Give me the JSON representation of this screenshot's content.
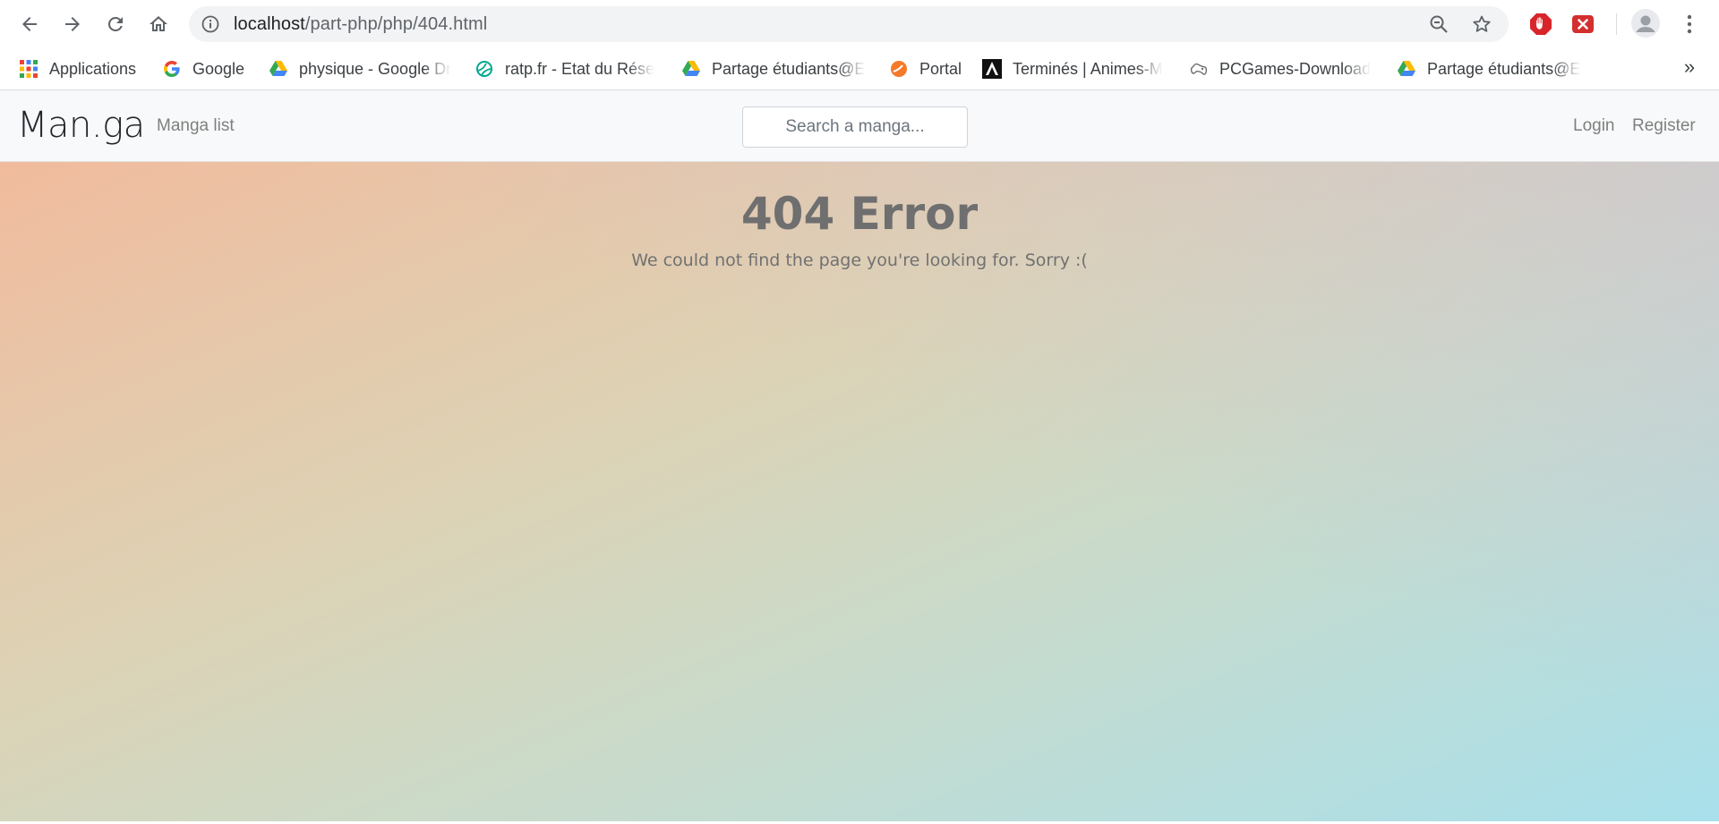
{
  "browser": {
    "url_host": "localhost",
    "url_path": "/part-php/php/404.html",
    "icons": {
      "back": "arrow-left",
      "forward": "arrow-right",
      "reload": "reload",
      "home": "home",
      "site_info": "info-circle",
      "zoom": "zoom-out",
      "bookmark_star": "star-outline",
      "extension_1": "adblock-hand",
      "extension_2": "red-close",
      "profile": "person",
      "menu": "vertical-dots"
    }
  },
  "bookmarks": {
    "items": [
      {
        "label": "Applications",
        "icon": "apps-grid"
      },
      {
        "label": "Google",
        "icon": "google-g"
      },
      {
        "label": "physique - Google Dr",
        "icon": "google-drive"
      },
      {
        "label": "ratp.fr - Etat du Rése",
        "icon": "ratp-logo"
      },
      {
        "label": "Partage étudiants@EI",
        "icon": "google-drive"
      },
      {
        "label": "Portal",
        "icon": "orange-portal"
      },
      {
        "label": "Terminés | Animes-M",
        "icon": "animes-logo"
      },
      {
        "label": "PCGames-Download",
        "icon": "gamepad"
      },
      {
        "label": "Partage étudiants@EI",
        "icon": "google-drive"
      }
    ],
    "overflow_label": "»"
  },
  "site": {
    "brand": "Man.ga",
    "nav": {
      "manga_list": "Manga list",
      "login": "Login",
      "register": "Register"
    },
    "search": {
      "placeholder": "Search a manga..."
    },
    "error": {
      "title": "404 Error",
      "message": "We could not find the page you're looking for. Sorry :("
    },
    "colors": {
      "gradient_top_left": "#f4b89a",
      "gradient_bottom_right": "#a8e0ec",
      "navbar_bg": "#f8f9fa"
    }
  }
}
